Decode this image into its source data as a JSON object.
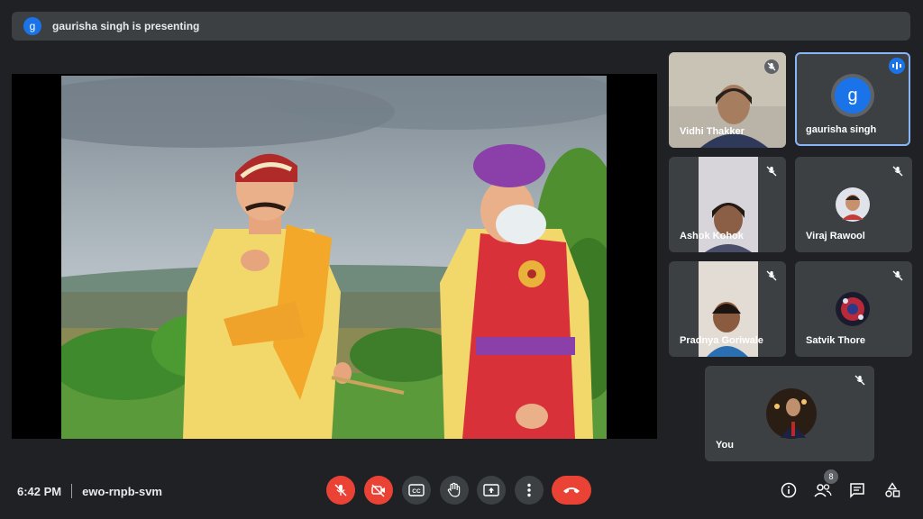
{
  "presenting": {
    "avatar_letter": "g",
    "text": "gaurisha singh is presenting"
  },
  "participants": [
    {
      "name": "Vidhi Thakker"
    },
    {
      "name": "gaurisha singh",
      "avatar_letter": "g"
    },
    {
      "name": "Ashok Kohok"
    },
    {
      "name": "Viraj Rawool"
    },
    {
      "name": "Pradnya Goriwale"
    },
    {
      "name": "Satvik Thore"
    },
    {
      "name": "You"
    }
  ],
  "meeting": {
    "time": "6:42 PM",
    "code": "ewo-rnpb-svm"
  },
  "people_count": "8",
  "colors": {
    "accent": "#8ab4f8",
    "danger": "#ea4335",
    "avatar": "#1a73e8",
    "tile": "#3c4043",
    "background": "#202124"
  }
}
